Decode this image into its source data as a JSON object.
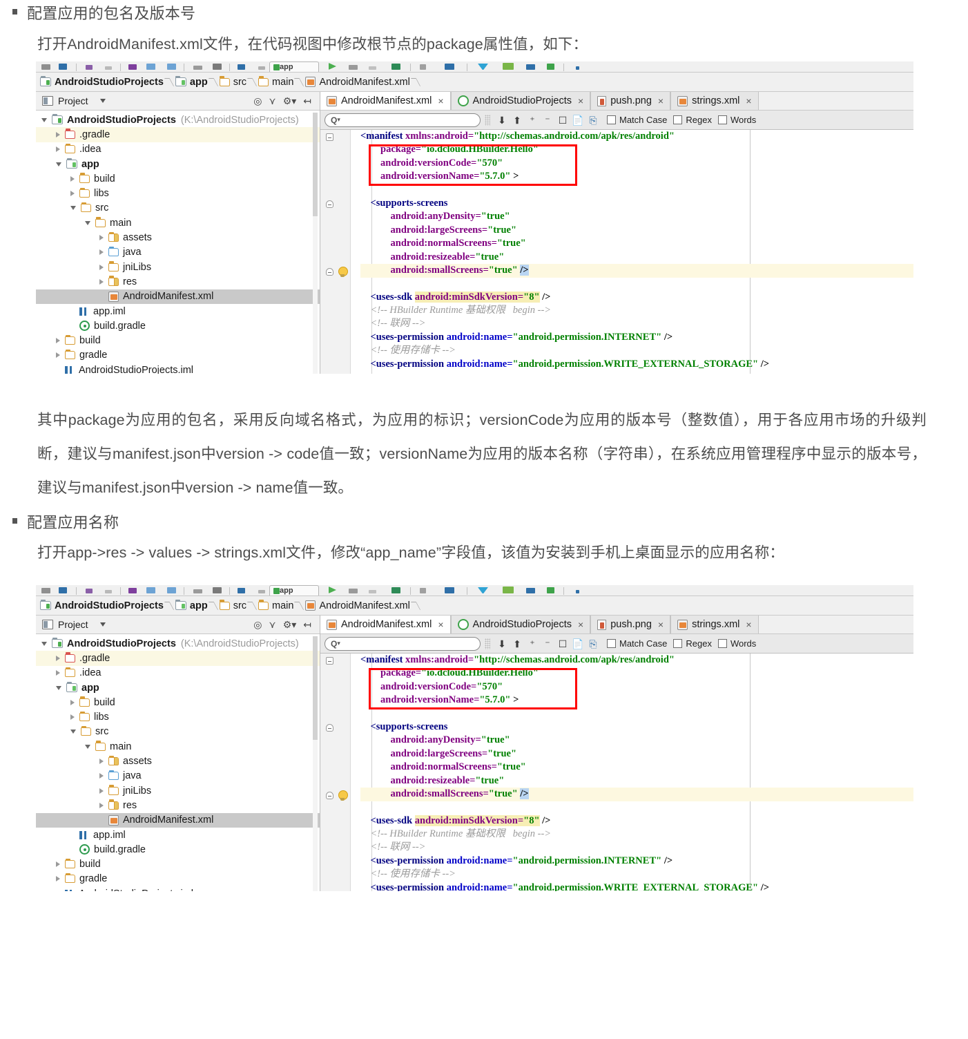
{
  "doc": {
    "section1": {
      "bullet": "配置应用的包名及版本号",
      "intro": "打开AndroidManifest.xml文件，在代码视图中修改根节点的package属性值，如下："
    },
    "explain": "其中package为应用的包名，采用反向域名格式，为应用的标识；versionCode为应用的版本号（整数值），用于各应用市场的升级判断，建议与manifest.json中version -> code值一致；versionName为应用的版本名称（字符串），在系统应用管理程序中显示的版本号，建议与manifest.json中version -> name值一致。",
    "section2": {
      "bullet": "配置应用名称",
      "intro": "打开app->res -> values -> strings.xml文件，修改“app_name”字段值，该值为安装到手机上桌面显示的应用名称："
    }
  },
  "ide": {
    "toolbar": {
      "run_config": "app"
    },
    "breadcrumb": [
      {
        "label": "AndroidStudioProjects",
        "icon": "module-icon",
        "bold": true
      },
      {
        "label": "app",
        "icon": "module-icon",
        "bold": true
      },
      {
        "label": "src",
        "icon": "folder-icon",
        "bold": false
      },
      {
        "label": "main",
        "icon": "folder-icon",
        "bold": false
      },
      {
        "label": "AndroidManifest.xml",
        "icon": "xml-file-icon",
        "bold": false
      }
    ],
    "project_panel": {
      "title": "Project",
      "tools": [
        "locate-icon",
        "collapse-all-icon",
        "settings-gear-icon",
        "hide-panel-icon"
      ],
      "tree": [
        {
          "label": "AndroidStudioProjects",
          "path": "(K:\\AndroidStudioProjects)",
          "indent": 0,
          "arrow": "down",
          "icon": "module-icon",
          "bold": true,
          "state": "normal"
        },
        {
          "label": ".gradle",
          "path": "",
          "indent": 1,
          "arrow": "right",
          "icon": "folder-red-icon",
          "bold": false,
          "state": "hover"
        },
        {
          "label": ".idea",
          "path": "",
          "indent": 1,
          "arrow": "right",
          "icon": "folder-icon",
          "bold": false,
          "state": "normal"
        },
        {
          "label": "app",
          "path": "",
          "indent": 1,
          "arrow": "down",
          "icon": "module-app-icon",
          "bold": true,
          "state": "normal"
        },
        {
          "label": "build",
          "path": "",
          "indent": 2,
          "arrow": "right",
          "icon": "folder-icon",
          "bold": false,
          "state": "normal"
        },
        {
          "label": "libs",
          "path": "",
          "indent": 2,
          "arrow": "right",
          "icon": "folder-icon",
          "bold": false,
          "state": "normal"
        },
        {
          "label": "src",
          "path": "",
          "indent": 2,
          "arrow": "down",
          "icon": "folder-icon",
          "bold": false,
          "state": "normal"
        },
        {
          "label": "main",
          "path": "",
          "indent": 3,
          "arrow": "down",
          "icon": "folder-icon",
          "bold": false,
          "state": "normal"
        },
        {
          "label": "assets",
          "path": "",
          "indent": 4,
          "arrow": "right",
          "icon": "folder-src-icon",
          "bold": false,
          "state": "normal"
        },
        {
          "label": "java",
          "path": "",
          "indent": 4,
          "arrow": "right",
          "icon": "folder-blue-icon",
          "bold": false,
          "state": "normal"
        },
        {
          "label": "jniLibs",
          "path": "",
          "indent": 4,
          "arrow": "right",
          "icon": "folder-icon",
          "bold": false,
          "state": "normal"
        },
        {
          "label": "res",
          "path": "",
          "indent": 4,
          "arrow": "right",
          "icon": "folder-src-icon",
          "bold": false,
          "state": "normal"
        },
        {
          "label": "AndroidManifest.xml",
          "path": "",
          "indent": 4,
          "arrow": "none",
          "icon": "xml-file-icon",
          "bold": false,
          "state": "selected"
        },
        {
          "label": "app.iml",
          "path": "",
          "indent": 2,
          "arrow": "none",
          "icon": "iml-file-icon",
          "bold": false,
          "state": "normal"
        },
        {
          "label": "build.gradle",
          "path": "",
          "indent": 2,
          "arrow": "none",
          "icon": "gradle-file-icon",
          "bold": false,
          "state": "normal"
        },
        {
          "label": "build",
          "path": "",
          "indent": 1,
          "arrow": "right",
          "icon": "folder-icon",
          "bold": false,
          "state": "normal"
        },
        {
          "label": "gradle",
          "path": "",
          "indent": 1,
          "arrow": "right",
          "icon": "folder-icon",
          "bold": false,
          "state": "normal"
        },
        {
          "label": "AndroidStudioProjects.iml",
          "path": "",
          "indent": 1,
          "arrow": "none",
          "icon": "iml-file-icon",
          "bold": false,
          "state": "normal"
        }
      ]
    },
    "editor_tabs": [
      {
        "label": "AndroidManifest.xml",
        "icon": "xml-file-icon",
        "active": true,
        "close": "×"
      },
      {
        "label": "AndroidStudioProjects",
        "icon": "android-studio-icon",
        "active": false,
        "close": "×"
      },
      {
        "label": "push.png",
        "icon": "png-file-icon",
        "active": false,
        "close": "×"
      },
      {
        "label": "strings.xml",
        "icon": "xml-file-icon",
        "active": false,
        "close": "×"
      }
    ],
    "find_bar": {
      "placeholder": "",
      "search_glyph": "Q",
      "buttons": [
        "find-prev-icon",
        "find-next-icon",
        "select-all-occurrences-icon",
        "exclude-icon",
        "preview-icon",
        "open-in-find-window-icon",
        "filter-icon"
      ],
      "options": [
        {
          "label": "Match Case",
          "checked": false
        },
        {
          "label": "Regex",
          "checked": false
        },
        {
          "label": "Words",
          "checked": false
        }
      ]
    },
    "code_lines": [
      {
        "indent": 0,
        "parts": [
          {
            "t": "<manifest ",
            "c": "tagn"
          },
          {
            "t": "xmlns:android=",
            "c": "attr"
          },
          {
            "t": "\"http://schemas.android.com/apk/res/android\"",
            "c": "val"
          }
        ]
      },
      {
        "indent": 2,
        "parts": [
          {
            "t": "package=",
            "c": "attr"
          },
          {
            "t": "\"io.dcloud.HBuilder.Hello\"",
            "c": "val"
          }
        ]
      },
      {
        "indent": 2,
        "parts": [
          {
            "t": "android:versionCode=",
            "c": "attr"
          },
          {
            "t": "\"570\"",
            "c": "val"
          }
        ]
      },
      {
        "indent": 2,
        "parts": [
          {
            "t": "android:versionName=",
            "c": "attr"
          },
          {
            "t": "\"5.7.0\"",
            "c": "val"
          },
          {
            "t": " >",
            "c": "op"
          }
        ]
      },
      {
        "indent": 0,
        "parts": []
      },
      {
        "indent": 1,
        "parts": [
          {
            "t": "<supports-screens",
            "c": "tagn"
          }
        ]
      },
      {
        "indent": 3,
        "parts": [
          {
            "t": "android:anyDensity=",
            "c": "attr"
          },
          {
            "t": "\"true\"",
            "c": "val"
          }
        ]
      },
      {
        "indent": 3,
        "parts": [
          {
            "t": "android:largeScreens=",
            "c": "attr"
          },
          {
            "t": "\"true\"",
            "c": "val"
          }
        ]
      },
      {
        "indent": 3,
        "parts": [
          {
            "t": "android:normalScreens=",
            "c": "attr"
          },
          {
            "t": "\"true\"",
            "c": "val"
          }
        ]
      },
      {
        "indent": 3,
        "parts": [
          {
            "t": "android:resizeable=",
            "c": "attr"
          },
          {
            "t": "\"true\"",
            "c": "val"
          }
        ]
      },
      {
        "indent": 3,
        "highlight_row": true,
        "parts": [
          {
            "t": "android:smallScreens=",
            "c": "attr"
          },
          {
            "t": "\"true\" ",
            "c": "val"
          },
          {
            "t": "/>",
            "c": "op hl-b"
          }
        ]
      },
      {
        "indent": 0,
        "parts": []
      },
      {
        "indent": 1,
        "parts": [
          {
            "t": "<uses-sdk ",
            "c": "tagn"
          },
          {
            "t": "android:minSdkVersion=",
            "c": "attr hl-y"
          },
          {
            "t": "\"8\"",
            "c": "val hl-y"
          },
          {
            "t": " />",
            "c": "op"
          }
        ]
      },
      {
        "indent": 1,
        "parts": [
          {
            "t": "<!-- HBuilder Runtime 基础权限   begin -->",
            "c": "cmt"
          }
        ]
      },
      {
        "indent": 1,
        "parts": [
          {
            "t": "<!-- 联网 -->",
            "c": "cmt"
          }
        ]
      },
      {
        "indent": 1,
        "parts": [
          {
            "t": "<uses-permission ",
            "c": "tagn"
          },
          {
            "t": "android:name=",
            "c": "attr2"
          },
          {
            "t": "\"android.permission.INTERNET\"",
            "c": "val"
          },
          {
            "t": " />",
            "c": "op"
          }
        ]
      },
      {
        "indent": 1,
        "parts": [
          {
            "t": "<!-- 使用存储卡 -->",
            "c": "cmt"
          }
        ]
      },
      {
        "indent": 1,
        "parts": [
          {
            "t": "<uses-permission ",
            "c": "tagn"
          },
          {
            "t": "android:name=",
            "c": "attr2"
          },
          {
            "t": "\"android.permission.WRITE_EXTERNAL_STORAGE\"",
            "c": "val"
          },
          {
            "t": " />",
            "c": "op"
          }
        ]
      }
    ],
    "annotation": {
      "color": "#ff0000",
      "shape": "rectangle",
      "covers": "package / versionCode / versionName lines"
    }
  }
}
